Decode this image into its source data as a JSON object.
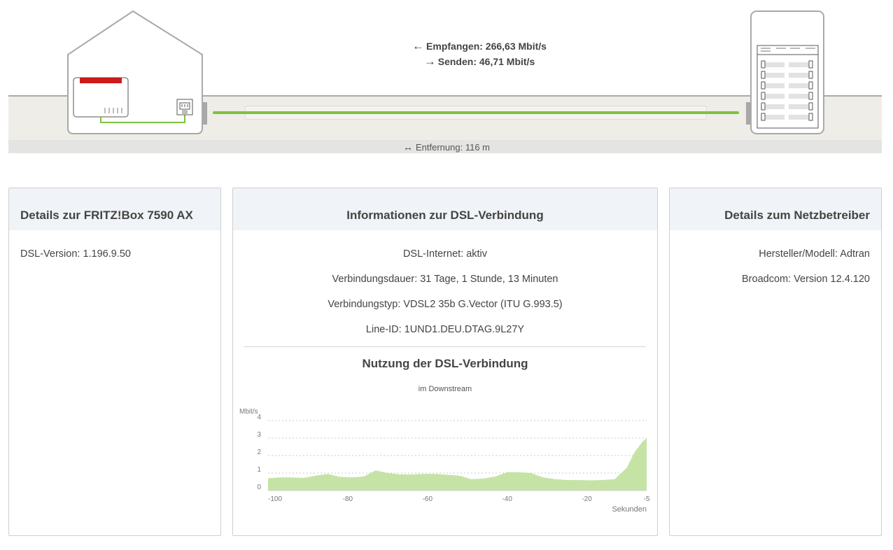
{
  "connection": {
    "receive_label": "Empfangen: 266,63 Mbit/s",
    "send_label": "Senden: 46,71 Mbit/s",
    "distance_label": "Entfernung: 116 m",
    "line_color": "#7dc142",
    "router_accent": "#cc1b1b"
  },
  "panels": {
    "device": {
      "title": "Details zur FRITZ!Box 7590 AX",
      "rows": [
        "DSL-Version: 1.196.9.50"
      ]
    },
    "connection": {
      "title": "Informationen zur DSL-Verbindung",
      "rows": [
        "DSL-Internet: aktiv",
        "Verbindungsdauer: 31 Tage, 1 Stunde, 13 Minuten",
        "Verbindungstyp: VDSL2 35b G.Vector (ITU G.993.5)",
        "Line-ID: 1UND1.DEU.DTAG.9L27Y"
      ]
    },
    "operator": {
      "title": "Details zum Netzbetreiber",
      "rows": [
        "Hersteller/Modell: Adtran",
        "Broadcom: Version 12.4.120"
      ]
    }
  },
  "usage": {
    "title": "Nutzung der DSL-Verbindung",
    "subtitle": "im Downstream"
  },
  "chart_data": {
    "type": "area",
    "title": "",
    "ylabel": "Mbit/s",
    "xlabel": "Sekunden",
    "xlim": [
      -100,
      -5
    ],
    "ylim": [
      0,
      4
    ],
    "x_ticks": [
      -100,
      -80,
      -60,
      -40,
      -20,
      -5
    ],
    "y_ticks": [
      0,
      1,
      2,
      3,
      4
    ],
    "grid": true,
    "fill_color": "#c5e3a5",
    "x": [
      -100,
      -97,
      -94,
      -91,
      -88,
      -85,
      -82,
      -79,
      -76,
      -73,
      -70,
      -67,
      -64,
      -61,
      -58,
      -55,
      -52,
      -49,
      -46,
      -43,
      -40,
      -37,
      -34,
      -31,
      -28,
      -25,
      -22,
      -19,
      -16,
      -13,
      -10,
      -8,
      -6,
      -5
    ],
    "values": [
      0.7,
      0.75,
      0.75,
      0.72,
      0.85,
      0.95,
      0.78,
      0.75,
      0.8,
      1.15,
      1.0,
      0.92,
      0.92,
      0.95,
      0.95,
      0.9,
      0.85,
      0.65,
      0.68,
      0.8,
      1.05,
      1.05,
      1.0,
      0.75,
      0.65,
      0.6,
      0.6,
      0.58,
      0.6,
      0.65,
      1.3,
      2.2,
      2.8,
      3.0
    ]
  }
}
